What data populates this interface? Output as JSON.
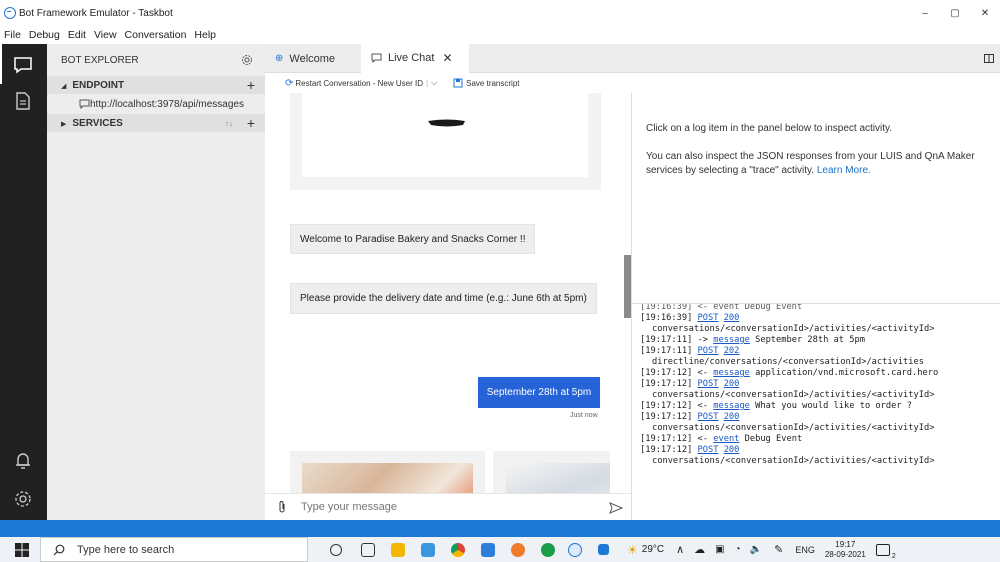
{
  "window": {
    "title": "Bot Framework Emulator - Taskbot",
    "controls": [
      "–",
      "▢",
      "✕"
    ]
  },
  "menu": [
    "File",
    "Debug",
    "Edit",
    "View",
    "Conversation",
    "Help"
  ],
  "explorer": {
    "title": "BOT EXPLORER",
    "endpoint_label": "ENDPOINT",
    "endpoint_url": "http://localhost:3978/api/messages",
    "services_label": "SERVICES"
  },
  "tabs": [
    {
      "label": "Welcome"
    },
    {
      "label": "Live Chat",
      "close": "✕"
    }
  ],
  "toolbar": {
    "restart_label": "Restart Conversation - New User ID",
    "save_label": "Save transcript"
  },
  "chat": {
    "messages": [
      {
        "from": "bot",
        "text": "Welcome to Paradise Bakery and Snacks Corner !!"
      },
      {
        "from": "bot",
        "text": "Please provide the delivery date and time (e.g.: June 6th at 5pm)"
      },
      {
        "from": "user",
        "text": "September 28th at 5pm",
        "timestamp": "Just now"
      }
    ],
    "input_placeholder": "Type your message"
  },
  "inspector": {
    "line1": "Click on a log item in the panel below to inspect activity.",
    "line2": "You can also inspect the JSON responses from your LUIS and QnA Maker services by selecting a \"trace\" activity.",
    "learn_more": "Learn More."
  },
  "log": [
    {
      "time": "[19:16:39]",
      "link": "POST",
      "code": "200",
      "cont": "conversations/<conversationId>/activities/<activityId>"
    },
    {
      "time": "[19:17:11]",
      "dir": "->",
      "link": "message",
      "text": "September 28th at 5pm"
    },
    {
      "time": "[19:17:11]",
      "link": "POST",
      "code": "202",
      "cont": "directline/conversations/<conversationId>/activities"
    },
    {
      "time": "[19:17:12]",
      "dir": "<-",
      "link": "message",
      "text": "application/vnd.microsoft.card.hero"
    },
    {
      "time": "[19:17:12]",
      "link": "POST",
      "code": "200",
      "cont": "conversations/<conversationId>/activities/<activityId>"
    },
    {
      "time": "[19:17:12]",
      "dir": "<-",
      "link": "message",
      "text": "What you would like to order ?"
    },
    {
      "time": "[19:17:12]",
      "link": "POST",
      "code": "200",
      "cont": "conversations/<conversationId>/activities/<activityId>"
    },
    {
      "time": "[19:17:12]",
      "dir": "<-",
      "link": "event",
      "text": "Debug Event"
    },
    {
      "time": "[19:17:12]",
      "link": "POST",
      "code": "200",
      "cont": "conversations/<conversationId>/activities/<activityId>"
    }
  ],
  "log_partial_top": "[19:16:39] <- event Debug Event",
  "taskbar": {
    "search_placeholder": "Type here to search",
    "weather": "29°C",
    "lang": "ENG",
    "time": "19:17",
    "date": "28-09-2021",
    "notifications": "2"
  },
  "colors": {
    "accent": "#1c78d4",
    "user_bubble": "#2563d6",
    "activity_bar": "#212121",
    "explorer_bg": "#ededed"
  }
}
